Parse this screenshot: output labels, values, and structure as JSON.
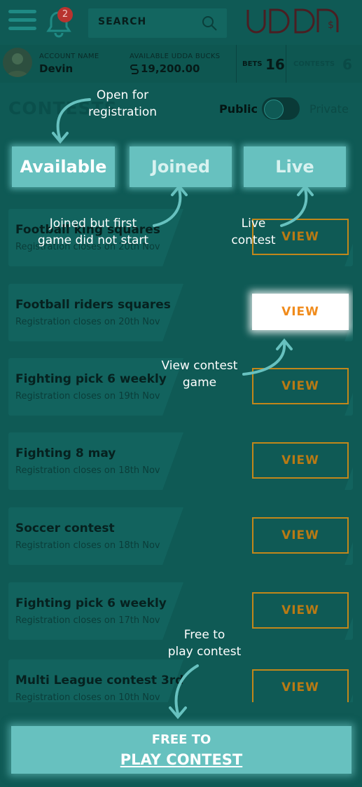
{
  "header": {
    "notification_count": "2",
    "search_placeholder": "SEARCH",
    "logo_text": "UDDA"
  },
  "account": {
    "name_label": "ACCOUNT NAME",
    "name": "Devin",
    "bucks_label": "AVAILABLE UDDA BUCKS",
    "bucks_value": "19,200.00",
    "bets_label": "BETS",
    "bets_count": "16",
    "contests_label": "CONTESTS",
    "contests_count": "6"
  },
  "page": {
    "title": "CONTESTS",
    "public_label": "Public",
    "private_label": "Private",
    "toggle_state": "public"
  },
  "tabs": [
    {
      "label": "Available"
    },
    {
      "label": "Joined"
    },
    {
      "label": "Live"
    }
  ],
  "contests": [
    {
      "title": "Football king squares",
      "sub": "Registration closes on 20th Nov",
      "action": "VIEW"
    },
    {
      "title": "Football riders squares",
      "sub": "Registration closes on 20th Nov",
      "action": "VIEW"
    },
    {
      "title": "Fighting pick 6 weekly",
      "sub": "Registration closes on 19th Nov",
      "action": "VIEW"
    },
    {
      "title": "Fighting 8 may",
      "sub": "Registration closes on 18th Nov",
      "action": "VIEW"
    },
    {
      "title": "Soccer contest",
      "sub": "Registration closes on 18th Nov",
      "action": "VIEW"
    },
    {
      "title": "Fighting pick 6 weekly",
      "sub": "Registration closes on 17th Nov",
      "action": "VIEW"
    },
    {
      "title": "Multi League contest 3rd",
      "sub": "Registration closes on 10th Nov",
      "action": "VIEW"
    }
  ],
  "bottom": {
    "line1": "FREE TO",
    "line2": "PLAY CONTEST"
  },
  "annotations": {
    "open": [
      "Open for",
      "registration"
    ],
    "joined": [
      "Joined but first",
      "game did not start"
    ],
    "live": [
      "Live",
      "contest"
    ],
    "view": [
      "View contest",
      "game"
    ],
    "free": [
      "Free to",
      "play contest"
    ]
  },
  "colors": {
    "overlay_bg": "#0f5a55",
    "highlight": "#67c1bf",
    "view_accent": "#f08b1b"
  }
}
